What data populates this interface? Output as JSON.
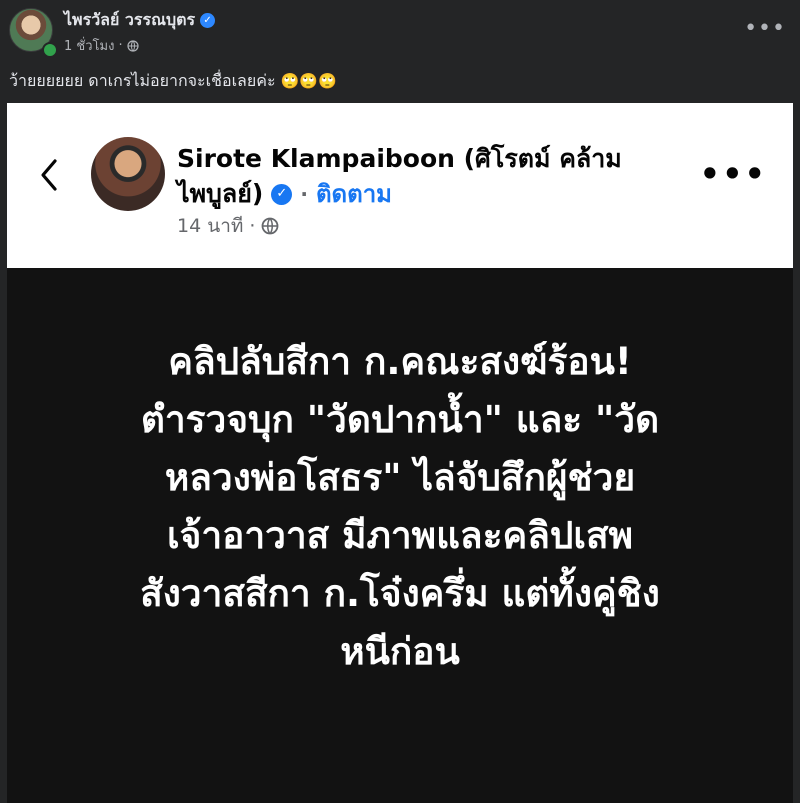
{
  "post": {
    "author": "ไพรวัลย์ วรรณบุตร",
    "time": "1 ชั่วโมง",
    "caption": "ว้ายยยยยย ดาเกรไม่อยากจะเชื่อเลยค่ะ",
    "caption_emoji": "🙄🙄🙄",
    "icons": {
      "verified": "verified-badge-icon",
      "privacy": "globe-icon",
      "more": "more-options-icon"
    }
  },
  "shared_image": {
    "author_line1": "Sirote Klampaiboon (ศิโรตม์ คล้าม",
    "author_line2": "ไพบูลย์)",
    "follow_label": "ติดตาม",
    "separator": "·",
    "time": "14 นาที",
    "headline_lines": [
      "คลิปลับสีกา ก.คณะสงฆ์ร้อน!",
      "ตำรวจบุก \"วัดปากน้ำ\" และ \"วัด",
      "หลวงพ่อโสธร\" ไล่จับสึกผู้ช่วย",
      "เจ้าอาวาส มีภาพและคลิปเสพ",
      "สังวาสสีกา ก.โจ๋งครึ่ม แต่ทั้งคู่ชิง",
      "หนีก่อน"
    ],
    "colors": {
      "headline": "#ffffff",
      "background": "#121212",
      "link": "#1877f2"
    }
  }
}
